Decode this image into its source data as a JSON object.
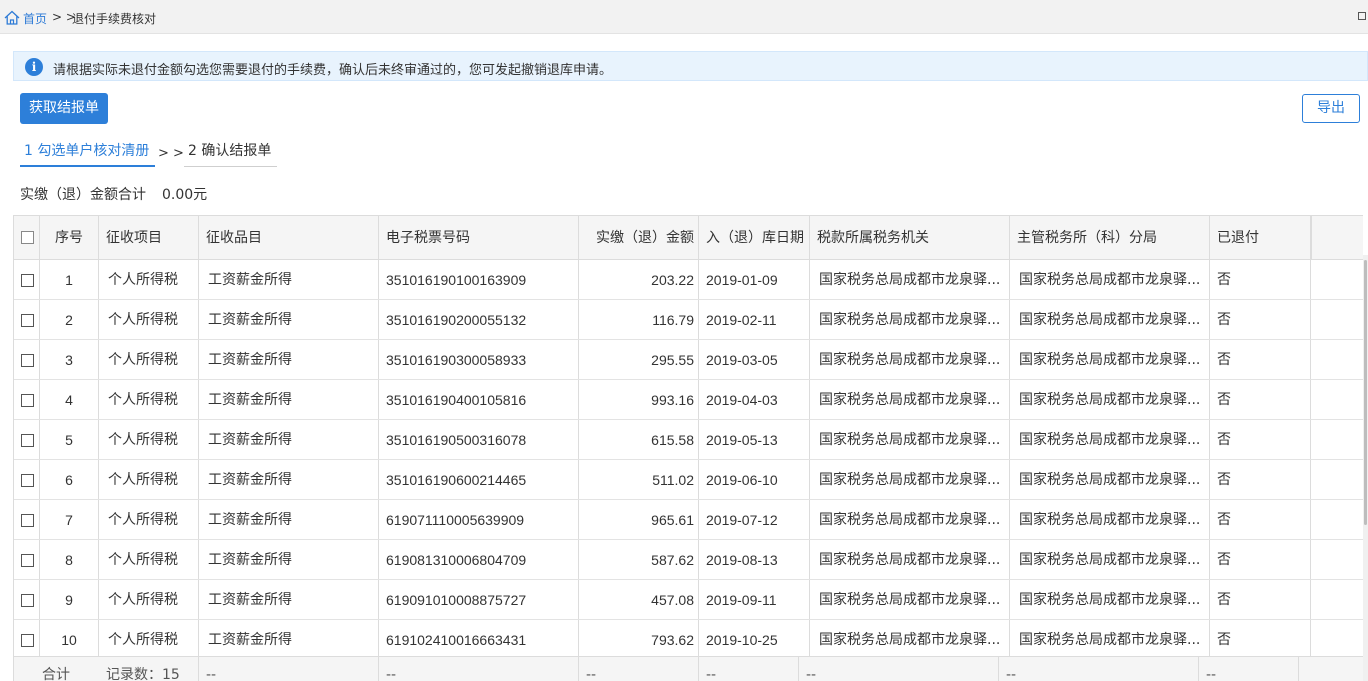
{
  "breadcrumb": {
    "home": "首页",
    "separator": "> >",
    "current": "退付手续费核对"
  },
  "notice": {
    "icon": "info-icon",
    "text": "请根据实际未退付金额勾选您需要退付的手续费，确认后未终审通过的，您可发起撤销退库申请。"
  },
  "toolbar": {
    "fetch_label": "获取结报单",
    "export_label": "导出"
  },
  "steps": {
    "step1": "1 勾选单户核对清册",
    "separator": "> >",
    "step2": "2 确认结报单"
  },
  "summary": {
    "label": "实缴（退）金额合计",
    "value": "0.00元"
  },
  "table": {
    "headers": [
      "序号",
      "征收项目",
      "征收品目",
      "电子税票号码",
      "实缴（退）金额",
      "入（退）库日期",
      "税款所属税务机关",
      "主管税务所（科）分局",
      "已退付"
    ],
    "rows": [
      [
        "1",
        "个人所得税",
        "工资薪金所得",
        "351016190100163909",
        "203.22",
        "2019-01-09",
        "国家税务总局成都市龙泉驿...",
        "国家税务总局成都市龙泉驿...",
        "否"
      ],
      [
        "2",
        "个人所得税",
        "工资薪金所得",
        "351016190200055132",
        "116.79",
        "2019-02-11",
        "国家税务总局成都市龙泉驿...",
        "国家税务总局成都市龙泉驿...",
        "否"
      ],
      [
        "3",
        "个人所得税",
        "工资薪金所得",
        "351016190300058933",
        "295.55",
        "2019-03-05",
        "国家税务总局成都市龙泉驿...",
        "国家税务总局成都市龙泉驿...",
        "否"
      ],
      [
        "4",
        "个人所得税",
        "工资薪金所得",
        "351016190400105816",
        "993.16",
        "2019-04-03",
        "国家税务总局成都市龙泉驿...",
        "国家税务总局成都市龙泉驿...",
        "否"
      ],
      [
        "5",
        "个人所得税",
        "工资薪金所得",
        "351016190500316078",
        "615.58",
        "2019-05-13",
        "国家税务总局成都市龙泉驿...",
        "国家税务总局成都市龙泉驿...",
        "否"
      ],
      [
        "6",
        "个人所得税",
        "工资薪金所得",
        "351016190600214465",
        "511.02",
        "2019-06-10",
        "国家税务总局成都市龙泉驿...",
        "国家税务总局成都市龙泉驿...",
        "否"
      ],
      [
        "7",
        "个人所得税",
        "工资薪金所得",
        "619071110005639909",
        "965.61",
        "2019-07-12",
        "国家税务总局成都市龙泉驿...",
        "国家税务总局成都市龙泉驿...",
        "否"
      ],
      [
        "8",
        "个人所得税",
        "工资薪金所得",
        "619081310006804709",
        "587.62",
        "2019-08-13",
        "国家税务总局成都市龙泉驿...",
        "国家税务总局成都市龙泉驿...",
        "否"
      ],
      [
        "9",
        "个人所得税",
        "工资薪金所得",
        "619091010008875727",
        "457.08",
        "2019-09-11",
        "国家税务总局成都市龙泉驿...",
        "国家税务总局成都市龙泉驿...",
        "否"
      ],
      [
        "10",
        "个人所得税",
        "工资薪金所得",
        "619102410016663431",
        "793.62",
        "2019-10-25",
        "国家税务总局成都市龙泉驿...",
        "国家税务总局成都市龙泉驿...",
        "否"
      ]
    ],
    "footer": [
      "合计",
      "记录数：15",
      "--",
      "--",
      "--",
      "--",
      "--",
      "--",
      "--"
    ]
  },
  "colors": {
    "accent": "#2d7fd9",
    "notice_bg": "#e8f3fd",
    "header_bg": "#f5f5f5"
  }
}
